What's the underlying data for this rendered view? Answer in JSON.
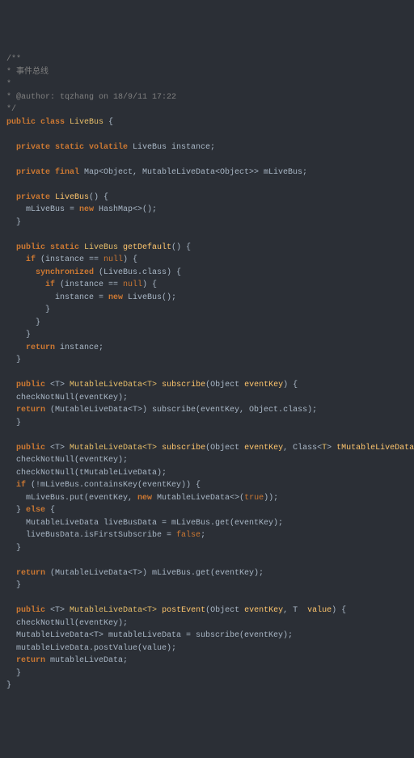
{
  "code": {
    "l01": "/**",
    "l02": "* 事件总线",
    "l03": "*",
    "l04": "* @author: tqzhang on 18/9/11 17:22",
    "l05": "*/",
    "l06a": "public class ",
    "l06b": "LiveBus",
    "l06c": " {",
    "l07": "",
    "l08a": "  private static volatile ",
    "l08b": "LiveBus instance;",
    "l09": "",
    "l10a": "  private final ",
    "l10b": "Map<Object, MutableLiveData<Object>> mLiveBus;",
    "l11": "",
    "l12a": "  private ",
    "l12b": "LiveBus",
    "l12c": "() {",
    "l13a": "    mLiveBus = ",
    "l13b": "new ",
    "l13c": "HashMap<>();",
    "l14": "  }",
    "l15": "",
    "l16a": "  public static ",
    "l16b": "LiveBus ",
    "l16c": "getDefault",
    "l16d": "() {",
    "l17a": "    if ",
    "l17b": "(instance == ",
    "l17c": "null",
    "l17d": ") {",
    "l18a": "      synchronized ",
    "l18b": "(LiveBus.class) {",
    "l19a": "        if ",
    "l19b": "(instance == ",
    "l19c": "null",
    "l19d": ") {",
    "l20a": "          instance = ",
    "l20b": "new ",
    "l20c": "LiveBus();",
    "l21": "        }",
    "l22": "      }",
    "l23": "    }",
    "l24a": "    return ",
    "l24b": "instance;",
    "l25": "  }",
    "l26": "",
    "l27a": "  public ",
    "l27b": "<T> ",
    "l27c": "MutableLiveData<T> ",
    "l27d": "subscribe",
    "l27e": "(Object ",
    "l27f": "eventKey",
    "l27g": ") {",
    "l28": "  checkNotNull(eventKey);",
    "l29a": "  return ",
    "l29b": "(MutableLiveData<T>) subscribe(eventKey, Object.class);",
    "l30": "  }",
    "l31": "",
    "l32a": "  public ",
    "l32b": "<T> ",
    "l32c": "MutableLiveData<T> ",
    "l32d": "subscribe",
    "l32e": "(Object ",
    "l32f": "eventKey",
    "l32g": ", Class<",
    "l32h": "T",
    "l32i": "> ",
    "l32j": "tMutableLiveData",
    "l32k": ") {",
    "l33": "  checkNotNull(eventKey);",
    "l34": "  checkNotNull(tMutableLiveData);",
    "l35a": "  if ",
    "l35b": "(!mLiveBus.containsKey(eventKey)) {",
    "l36a": "    mLiveBus.put(eventKey, ",
    "l36b": "new ",
    "l36c": "MutableLiveData<>(",
    "l36d": "true",
    "l36e": "));",
    "l37a": "  } ",
    "l37b": "else ",
    "l37c": "{",
    "l38": "    MutableLiveData liveBusData = mLiveBus.get(eventKey);",
    "l39a": "    liveBusData.isFirstSubscribe = ",
    "l39b": "false",
    "l39c": ";",
    "l40": "  }",
    "l41": "",
    "l42a": "  return ",
    "l42b": "(MutableLiveData<T>) mLiveBus.get(eventKey);",
    "l43": "  }",
    "l44": "",
    "l45a": "  public ",
    "l45b": "<T> ",
    "l45c": "MutableLiveData<T> ",
    "l45d": "postEvent",
    "l45e": "(Object ",
    "l45f": "eventKey",
    "l45g": ", T  ",
    "l45h": "value",
    "l45i": ") {",
    "l46": "  checkNotNull(eventKey);",
    "l47": "  MutableLiveData<T> mutableLiveData = subscribe(eventKey);",
    "l48": "  mutableLiveData.postValue(value);",
    "l49a": "  return ",
    "l49b": "mutableLiveData;",
    "l50": "  }",
    "l51": "}"
  }
}
